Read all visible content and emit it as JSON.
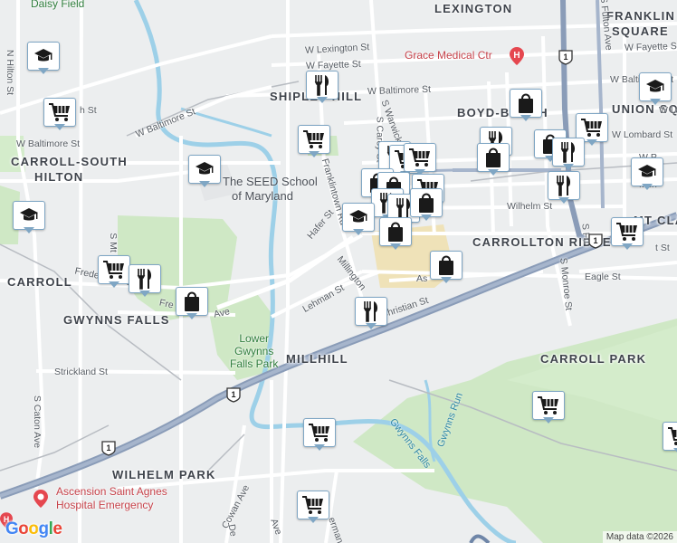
{
  "neighborhoods": {
    "lexington": "LEXINGTON",
    "franklin_square_1": "FRANKLIN",
    "franklin_square_2": "SQUARE",
    "shipley_hill": "SHIPLEY HILL",
    "boyd_booth": "BOYD-BOOTH",
    "union_square": "UNION SQ",
    "carroll_south_hilton_1": "CARROLL-SOUTH",
    "carroll_south_hilton_2": "HILTON",
    "carrollton_ridge": "CARROLLTON RIDGE",
    "mt_clare": "MT CLA",
    "carroll": "CARROLL",
    "gwynns_falls": "GWYNNS FALLS",
    "millhill": "MILLHILL",
    "carroll_park": "CARROLL PARK",
    "wilhelm_park": "WILHELM PARK",
    "daisy_field": "Daisy Field"
  },
  "streets": {
    "w_lexington": "W Lexington St",
    "w_fayette_west": "W Fayette St",
    "w_fayette_east": "W Fayette St",
    "w_baltimore_north": "W Baltimore St",
    "w_baltimore_left": "W Baltimore St",
    "w_baltimore_diag": "W Baltimore St",
    "w_lombard": "W Lombard St",
    "n_hilton": "N Hilton St",
    "frederick_ave": "Frederick Ave",
    "frederick_ave_2": "Fre",
    "frederick_ave_3": "Ave",
    "franklintown_rd": "Franklintown Rd",
    "hafer_st": "Hafer St",
    "millington": "Millington",
    "lehman_st": "Lehman St",
    "strickland_st": "Strickland St",
    "s_caton_ave": "S Caton Ave",
    "s_monroe_st": "S Monroe St",
    "s_fulton": "S Fu",
    "eagle_st": "Eagle St",
    "wilhelm_st": "Wilhelm St",
    "cowan_ave": "Cowan Ave",
    "s_carey": "S Carey St",
    "s_warwick": "S Warwick",
    "christian_st": "Christian St",
    "mcht": "Mch",
    "w_pratt": "W P",
    "ash": "As",
    "s_mt": "S Mt",
    "s_fulton_ave": "S Fulton Ave",
    "w_la": "W La",
    "t_st": "t St",
    "h_st": "h St",
    "ave_right": "Ave",
    "de": "De",
    "erman": "erman",
    "s_ca": "S Ca"
  },
  "parks": {
    "lower_gwynns_falls_park": [
      "Lower",
      "Gwynns",
      "Falls Park"
    ],
    "seed_school": [
      "The SEED School",
      "of Maryland"
    ]
  },
  "water": {
    "gwynns_run": "Gwynns Run",
    "gwynns_falls": "Gwynns Falls"
  },
  "pois": {
    "grace_medical": "Grace Medical Ctr",
    "ascension": [
      "Ascension Saint Agnes",
      "Hospital Emergency"
    ]
  },
  "route_shield": "1",
  "pin_icons": [
    "school-icon",
    "shopping-cart-icon",
    "restaurant-icon",
    "shopping-bag-icon"
  ],
  "colors": {
    "map_bg": "#eceeef",
    "park": "#cfe8c5",
    "pin_border": "#7fa6c4",
    "pin_icon": "#1a1a1a",
    "highway": "#8a9cb8",
    "water": "#9dd0e8",
    "poi_red": "#e5474f"
  },
  "attribution": "Map data ©2026",
  "google_logo": "Google"
}
